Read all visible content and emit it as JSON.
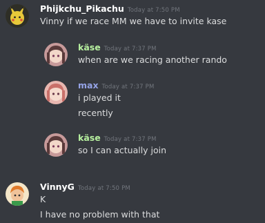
{
  "messages": [
    {
      "username": "Phijkchu_Pikachu",
      "username_color": "#ffffff",
      "timestamp": "Today at 7:50 PM",
      "avatar": "pikachu-avatar-icon",
      "lines": [
        "Vinny if we race MM we have to invite kase"
      ]
    },
    {
      "username": "käse",
      "username_color": "#b8f2a0",
      "timestamp": "Today at 7:37 PM",
      "avatar": "anime-girl-avatar-icon",
      "lines": [
        "when are we racing another rando"
      ]
    },
    {
      "username": "max",
      "username_color": "#95a3e6",
      "timestamp": "Today at 7:37 PM",
      "avatar": "anime-girl-avatar-icon",
      "lines": [
        "i played it",
        "recently"
      ]
    },
    {
      "username": "käse",
      "username_color": "#b8f2a0",
      "timestamp": "Today at 7:37 PM",
      "avatar": "anime-girl-avatar-icon",
      "lines": [
        "so I can actually join"
      ]
    },
    {
      "username": "VinnyG",
      "username_color": "#ffffff",
      "timestamp": "Today at 7:50 PM",
      "avatar": "character-avatar-icon",
      "lines": [
        "K",
        "I have no problem with that"
      ]
    }
  ],
  "colors": {
    "background": "#36393f",
    "text": "#dcddde",
    "timestamp": "#72767d"
  }
}
